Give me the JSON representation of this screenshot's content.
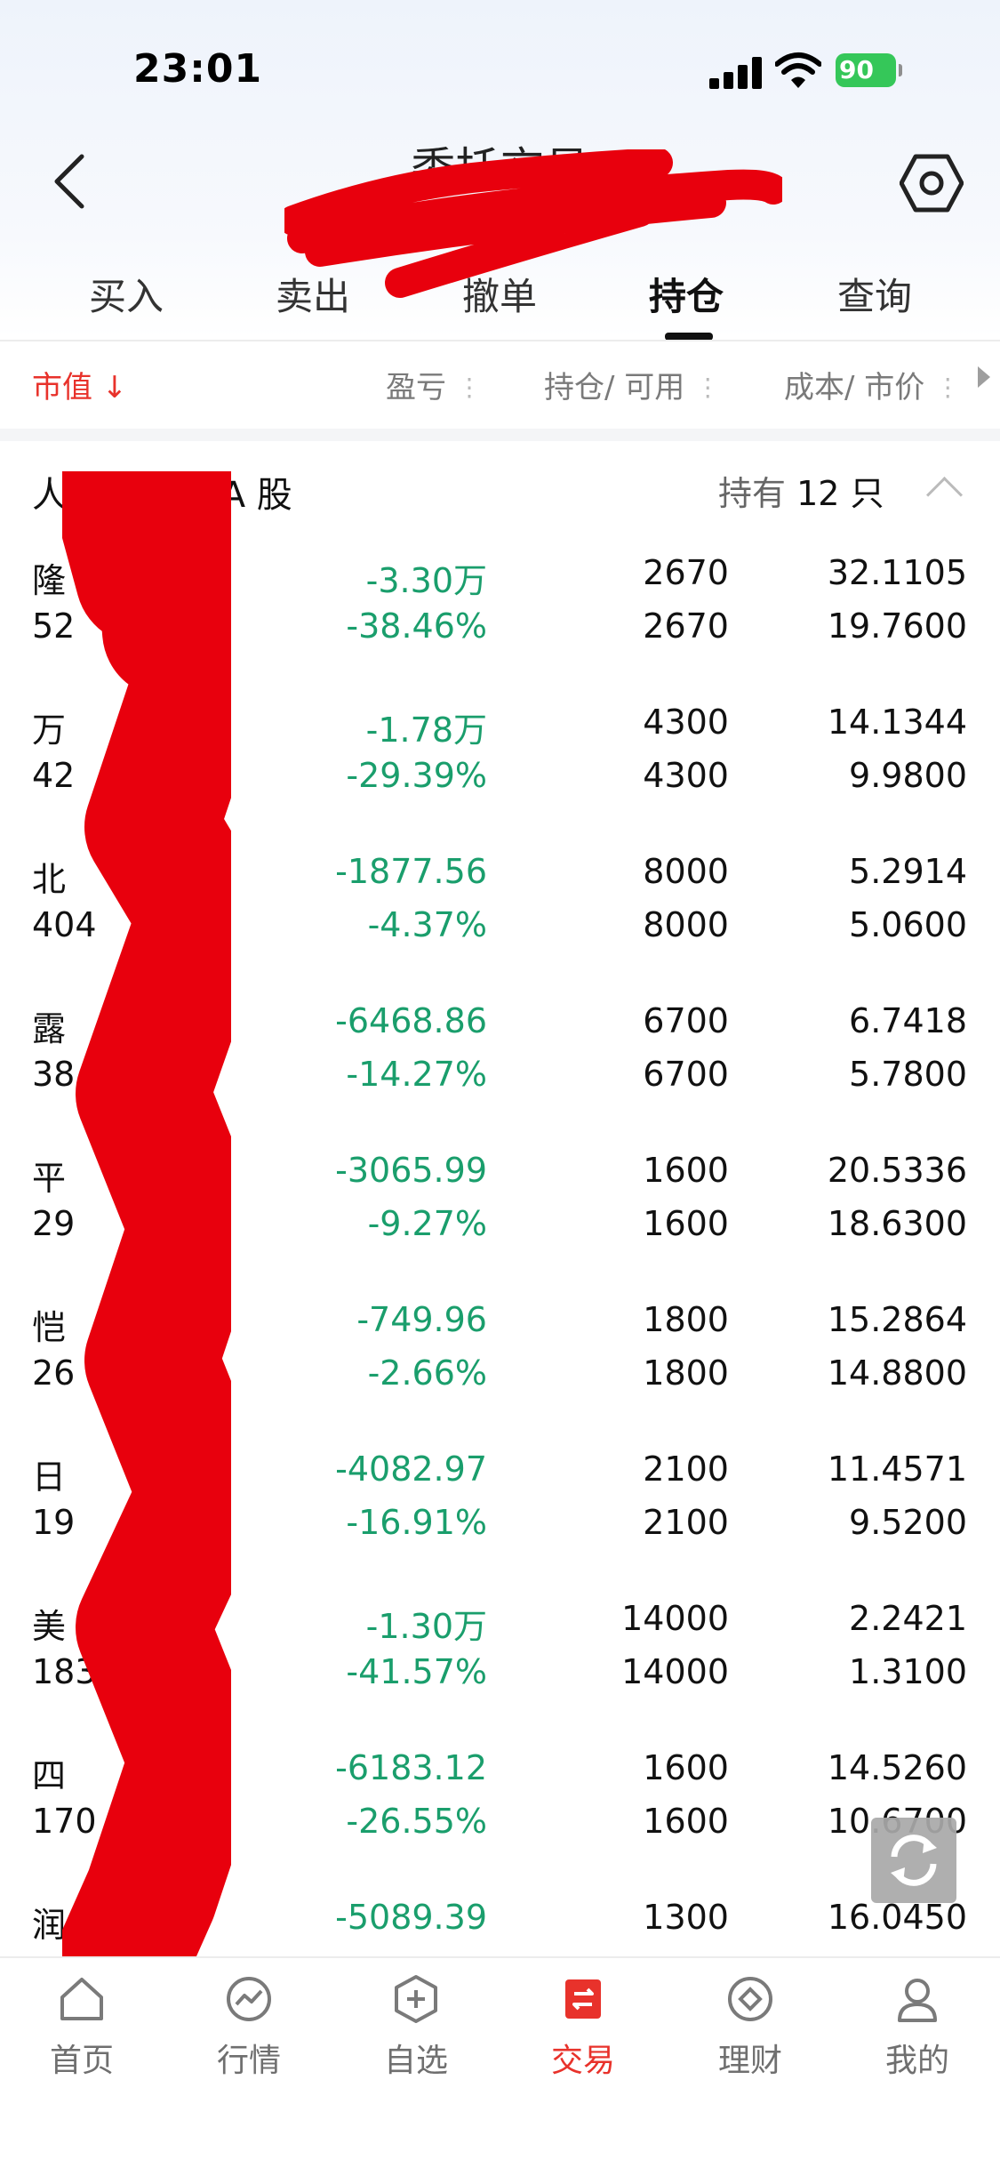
{
  "status": {
    "time": "23:01",
    "battery": "90"
  },
  "nav": {
    "title": "委托交易"
  },
  "tabs": [
    "买入",
    "卖出",
    "撤单",
    "持仓",
    "查询"
  ],
  "active_tab": "持仓",
  "columns": {
    "market_value": "市值 ↓",
    "pnl": "盈亏",
    "position": "持仓/ 可用",
    "cost": "成本/ 市价"
  },
  "account": {
    "label": "人民币账户 A 股",
    "hold_prefix": "持有",
    "hold_count": "12",
    "hold_suffix": "只"
  },
  "holdings": [
    {
      "name": "隆",
      "code": "52",
      "pnl": "-3.30万",
      "pnl_pct": "-38.46%",
      "qty": "2670",
      "avail": "2670",
      "cost": "32.1105",
      "price": "19.7600"
    },
    {
      "name": "万",
      "code": "42",
      "pnl": "-1.78万",
      "pnl_pct": "-29.39%",
      "qty": "4300",
      "avail": "4300",
      "cost": "14.1344",
      "price": "9.9800"
    },
    {
      "name": "北",
      "code": "404",
      "pnl": "-1877.56",
      "pnl_pct": "-4.37%",
      "qty": "8000",
      "avail": "8000",
      "cost": "5.2914",
      "price": "5.0600"
    },
    {
      "name": "露",
      "code": "38",
      "pnl": "-6468.86",
      "pnl_pct": "-14.27%",
      "qty": "6700",
      "avail": "6700",
      "cost": "6.7418",
      "price": "5.7800"
    },
    {
      "name": "平",
      "code": "29",
      "pnl": "-3065.99",
      "pnl_pct": "-9.27%",
      "qty": "1600",
      "avail": "1600",
      "cost": "20.5336",
      "price": "18.6300"
    },
    {
      "name": "恺",
      "code": "26",
      "pnl": "-749.96",
      "pnl_pct": "-2.66%",
      "qty": "1800",
      "avail": "1800",
      "cost": "15.2864",
      "price": "14.8800"
    },
    {
      "name": "日",
      "code": "19",
      "pnl": "-4082.97",
      "pnl_pct": "-16.91%",
      "qty": "2100",
      "avail": "2100",
      "cost": "11.4571",
      "price": "9.5200"
    },
    {
      "name": "美",
      "code": "183",
      "pnl": "-1.30万",
      "pnl_pct": "-41.57%",
      "qty": "14000",
      "avail": "14000",
      "cost": "2.2421",
      "price": "1.3100"
    },
    {
      "name": "四",
      "code": "170",
      "pnl": "-6183.12",
      "pnl_pct": "-26.55%",
      "qty": "1600",
      "avail": "1600",
      "cost": "14.5260",
      "price": "10.6700"
    },
    {
      "name": "润",
      "code": "",
      "pnl": "-5089.39",
      "pnl_pct": "",
      "qty": "1300",
      "avail": "",
      "cost": "16.0450",
      "price": ""
    }
  ],
  "bottom_nav": [
    {
      "label": "首页",
      "icon": "home-icon"
    },
    {
      "label": "行情",
      "icon": "market-chart-icon"
    },
    {
      "label": "自选",
      "icon": "watchlist-plus-icon"
    },
    {
      "label": "交易",
      "icon": "trade-exchange-icon"
    },
    {
      "label": "理财",
      "icon": "wealth-diamond-icon"
    },
    {
      "label": "我的",
      "icon": "profile-icon"
    }
  ],
  "colors": {
    "accent_red": "#e8322b",
    "loss_green": "#1a9e6c",
    "redaction": "#e8000d"
  }
}
